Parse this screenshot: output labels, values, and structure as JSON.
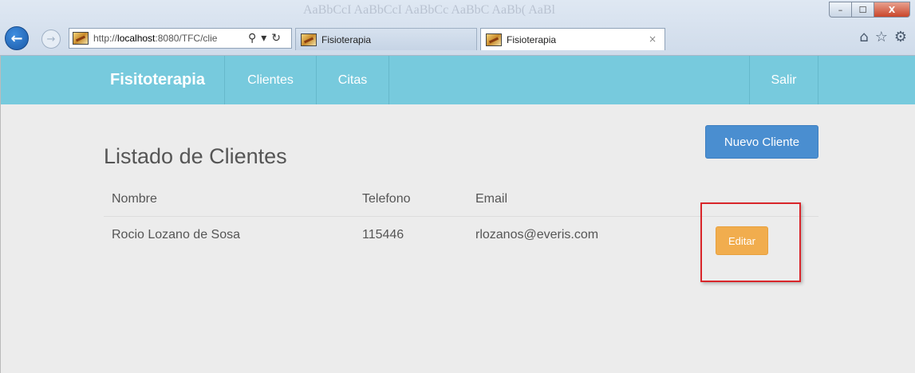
{
  "browser": {
    "window_controls": {
      "minimize": "–",
      "maximize": "☐",
      "close": "X"
    },
    "nav": {
      "back_icon": "←",
      "forward_icon": "→"
    },
    "address": {
      "url_prefix": "http://",
      "url_host": "localhost",
      "url_rest": ":8080/TFC/clie",
      "search_icon": "⚲",
      "dropdown_icon": "▾",
      "refresh_icon": "↻"
    },
    "tabs": [
      {
        "label": "Fisioterapia",
        "active": false
      },
      {
        "label": "Fisioterapia",
        "active": true,
        "close": "×"
      }
    ],
    "ribbon_ghost": "AaBbCcI  AaBbCcI  AaBbCc  AaBbC  AaBb(  AaBl",
    "tool_icons": {
      "home": "⌂",
      "favorites": "☆",
      "settings": "⚙"
    }
  },
  "navbar": {
    "brand": "Fisitoterapia",
    "items": [
      "Clientes",
      "Citas"
    ],
    "right_item": "Salir",
    "color": "#77cadd"
  },
  "main": {
    "title": "Listado de Clientes",
    "new_button": "Nuevo Cliente",
    "table": {
      "headers": [
        "Nombre",
        "Telefono",
        "Email"
      ],
      "rows": [
        {
          "nombre": "Rocio Lozano de Sosa",
          "telefono": "115446",
          "email": "rlozanos@everis.com",
          "action": "Editar"
        }
      ]
    }
  },
  "colors": {
    "primary_button": "#4a8ed0",
    "warning_button": "#f1ad4e",
    "highlight": "#d9262b",
    "background": "#ececec"
  }
}
